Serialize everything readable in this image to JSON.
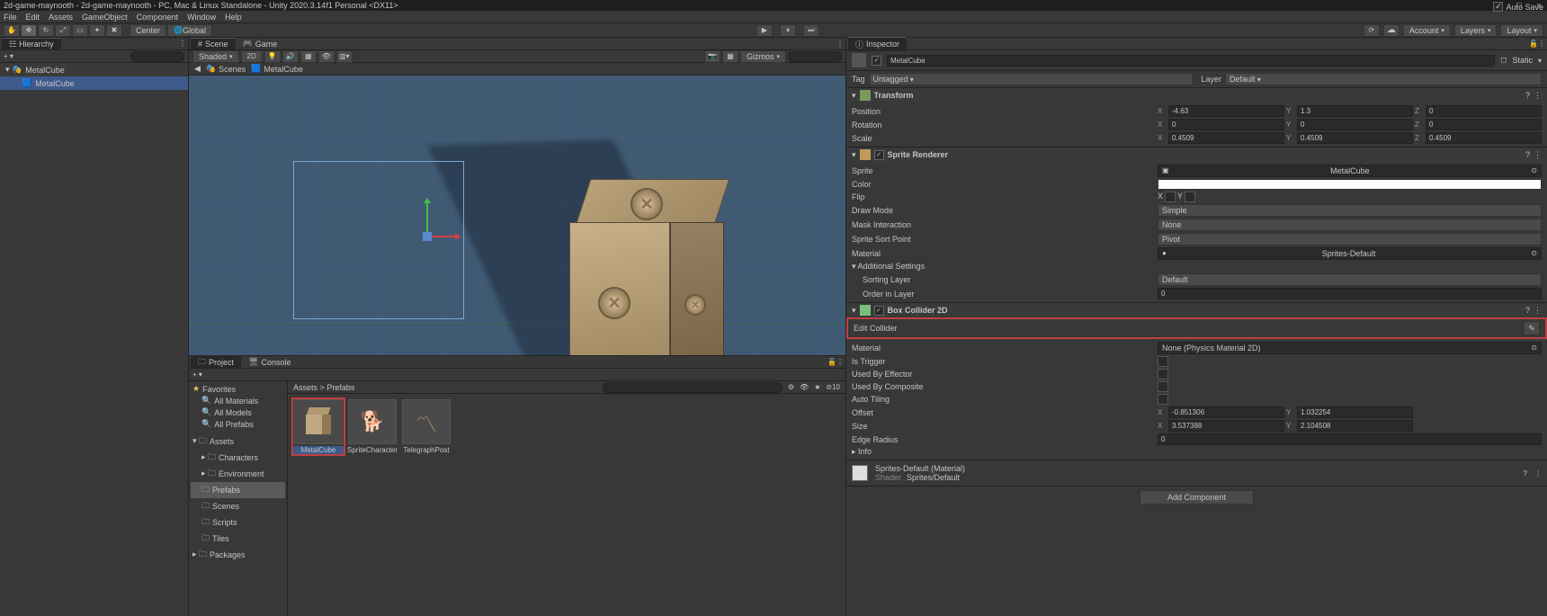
{
  "titlebar": "2d-game-maynooth - 2d-game-maynooth - PC, Mac & Linux Standalone - Unity 2020.3.14f1 Personal <DX11>",
  "menubar": [
    "File",
    "Edit",
    "Assets",
    "GameObject",
    "Component",
    "Window",
    "Help"
  ],
  "toolbar": {
    "pivot": "Center",
    "space": "Global",
    "account": "Account",
    "layers": "Layers",
    "layout": "Layout"
  },
  "hierarchy": {
    "title": "Hierarchy",
    "scene": "MetalCube",
    "item": "MetalCube"
  },
  "sceneview": {
    "tabs": {
      "scene": "Scene",
      "game": "Game"
    },
    "shading": "Shaded",
    "twod": "2D",
    "gizmos": "Gizmos",
    "autosave": "Auto Save",
    "crumb": {
      "scenes": "Scenes",
      "asset": "MetalCube"
    }
  },
  "project": {
    "tabs": {
      "project": "Project",
      "console": "Console"
    },
    "favorites": "Favorites",
    "allmat": "All Materials",
    "allmod": "All Models",
    "allpre": "All Prefabs",
    "assets": "Assets",
    "characters": "Characters",
    "environment": "Environment",
    "prefabs": "Prefabs",
    "scenes": "Scenes",
    "scripts": "Scripts",
    "tiles": "Tiles",
    "packages": "Packages",
    "path": {
      "assets": "Assets",
      "sep": ">",
      "prefabs": "Prefabs"
    },
    "items": [
      {
        "name": "MetalCube"
      },
      {
        "name": "SpriteCharacter"
      },
      {
        "name": "TelegraphPost"
      }
    ]
  },
  "inspector": {
    "title": "Inspector",
    "name": "MetalCube",
    "static": "Static",
    "taglbl": "Tag",
    "tag": "Untagged",
    "layerlbl": "Layer",
    "layer": "Default",
    "transform": {
      "title": "Transform",
      "position": {
        "label": "Position",
        "x": "-4.63",
        "y": "1.3",
        "z": "0"
      },
      "rotation": {
        "label": "Rotation",
        "x": "0",
        "y": "0",
        "z": "0"
      },
      "scale": {
        "label": "Scale",
        "x": "0.4509",
        "y": "0.4509",
        "z": "0.4509"
      }
    },
    "sprite": {
      "title": "Sprite Renderer",
      "sprite": "Sprite",
      "spriteval": "MetalCube",
      "color": "Color",
      "flip": "Flip",
      "flipx": "X",
      "flipy": "Y",
      "draw": "Draw Mode",
      "drawval": "Simple",
      "mask": "Mask Interaction",
      "maskval": "None",
      "sort": "Sprite Sort Point",
      "sortval": "Pivot",
      "mat": "Material",
      "matval": "Sprites-Default",
      "addl": "Additional Settings",
      "sortlayer": "Sorting Layer",
      "sortlayerval": "Default",
      "order": "Order in Layer",
      "orderval": "0"
    },
    "collider": {
      "title": "Box Collider 2D",
      "edit": "Edit Collider",
      "mat": "Material",
      "matval": "None (Physics Material 2D)",
      "trigger": "Is Trigger",
      "effector": "Used By Effector",
      "composite": "Used By Composite",
      "tiling": "Auto Tiling",
      "offset": "Offset",
      "offsetx": "-0.851306",
      "offsety": "1.032254",
      "size": "Size",
      "sizex": "3.537388",
      "sizey": "2.104508",
      "edge": "Edge Radius",
      "edgeval": "0",
      "info": "Info"
    },
    "material": {
      "title": "Sprites-Default (Material)",
      "shader": "Shader",
      "shaderval": "Sprites/Default"
    },
    "addcomp": "Add Component"
  }
}
